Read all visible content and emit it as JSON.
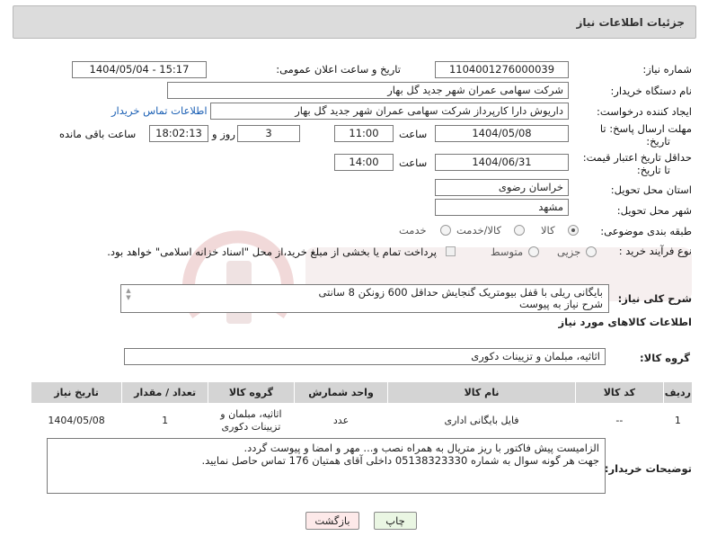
{
  "header": {
    "title": "جزئیات اطلاعات نیاز"
  },
  "fields": {
    "need_number_label": "شماره نیاز:",
    "need_number": "1104001276000039",
    "announce_label": "تاریخ و ساعت اعلان عمومی:",
    "announce_value": "1404/05/04 - 15:17",
    "buyer_org_label": "نام دستگاه خریدار:",
    "buyer_org": "شرکت سهامی عمران شهر جدید گل بهار",
    "creator_label": "ایجاد کننده درخواست:",
    "creator": "داریوش دارا کارپرداز شرکت سهامی عمران شهر جدید گل بهار",
    "buyer_contact_link": "اطلاعات تماس خریدار",
    "deadline_label_1": "مهلت ارسال پاسخ: تا",
    "deadline_label_2": "تاریخ:",
    "deadline_date": "1404/05/08",
    "time_label": "ساعت",
    "deadline_time": "11:00",
    "days_value": "3",
    "days_label": "روز و",
    "remaining_time": "18:02:13",
    "remaining_label": "ساعت باقی مانده",
    "price_validity_label_1": "حداقل تاریخ اعتبار قیمت:",
    "price_validity_label_2": "تا تاریخ:",
    "price_validity_date": "1404/06/31",
    "price_validity_time": "14:00",
    "province_label": "استان محل تحویل:",
    "province": "خراسان رضوی",
    "city_label": "شهر محل تحویل:",
    "city": "مشهد",
    "category_label": "طبقه بندی موضوعی:",
    "category_options": [
      "کالا",
      "کالا/خدمت",
      "خدمت"
    ],
    "process_label": "نوع فرآیند خرید :",
    "process_options": [
      "جزیی",
      "متوسط"
    ],
    "payment_note": "پرداخت تمام یا بخشی از مبلغ خرید،از محل \"اسناد خزانه اسلامی\" خواهد بود."
  },
  "description": {
    "label": "شرح کلی نیاز:",
    "line1": "بایگانی ریلی با قفل بیومتریک گنجایش حداقل 600 زونکن 8 سانتی",
    "line2": "شرح نیاز به پیوست"
  },
  "goods": {
    "section_title": "اطلاعات کالاهای مورد نیاز",
    "group_label": "گروه کالا:",
    "group_value": "اثاثیه، مبلمان و تزیینات دکوری"
  },
  "table": {
    "headers": [
      "ردیف",
      "کد کالا",
      "نام کالا",
      "واحد شمارش",
      "گروه کالا",
      "تعداد / مقدار",
      "تاریخ نیاز"
    ],
    "rows": [
      [
        "1",
        "--",
        "فایل بایگانی اداری",
        "عدد",
        "اثاثیه، مبلمان و تزیینات دکوری",
        "1",
        "1404/05/08"
      ]
    ]
  },
  "buyer_notes": {
    "label": "توضیحات خریدار:",
    "line1": "الزامیست پیش فاکتور با ریز متریال به همراه نصب و... مهر و امضا و پیوست گردد.",
    "line2": "جهت هر گونه سوال به شماره 05138323330 داخلی آقای همتیان 176 تماس حاصل نمایید."
  },
  "buttons": {
    "print": "چاپ",
    "back": "بازگشت"
  },
  "colors": {
    "panel": "#dcdcdc",
    "link": "#1a5fb4",
    "table_header": "#d4d4d4",
    "print_bg": "#eaf6e3",
    "back_bg": "#fde9e9"
  }
}
